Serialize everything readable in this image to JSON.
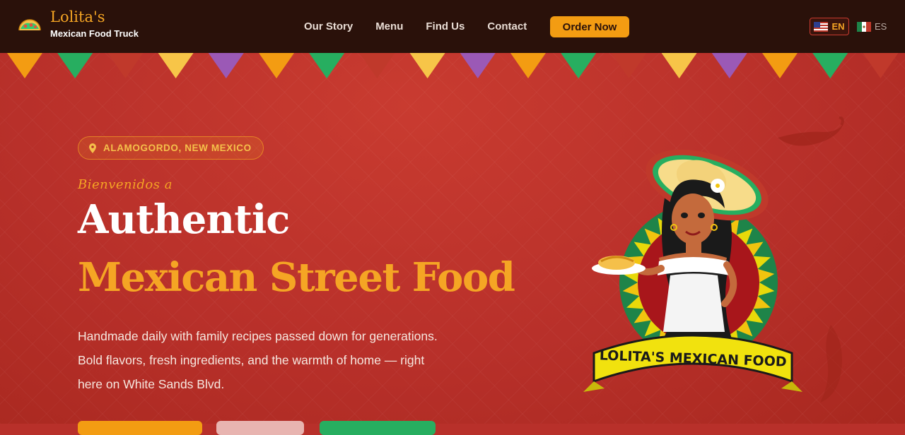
{
  "brand": {
    "name": "Lolita's",
    "tagline": "Mexican Food Truck",
    "icon": "taco-icon"
  },
  "nav": {
    "links": [
      "Our Story",
      "Menu",
      "Find Us",
      "Contact"
    ],
    "order_button": "Order Now"
  },
  "language": {
    "options": [
      {
        "code": "EN",
        "flag": "us-flag-icon",
        "active": true
      },
      {
        "code": "ES",
        "flag": "mexico-flag-icon",
        "active": false
      }
    ]
  },
  "hero": {
    "location": "ALAMOGORDO, NEW MEXICO",
    "greeting": "Bienvenidos a",
    "headline_line1": "Authentic",
    "headline_line2": "Mexican Street Food",
    "description": "Handmade daily with family recipes passed down for generations. Bold flavors, fresh ingredients, and the warmth of home — right here on White Sands Blvd.",
    "illustration_banner": "LOLITA'S MEXICAN FOOD"
  },
  "colors": {
    "nav_bg": "#2a110a",
    "accent": "#f39c12",
    "hero_bg": "#b8302a",
    "bunting": [
      "#f39c12",
      "#27ae60",
      "#c0392b",
      "#f7c548",
      "#9b59b6"
    ]
  }
}
